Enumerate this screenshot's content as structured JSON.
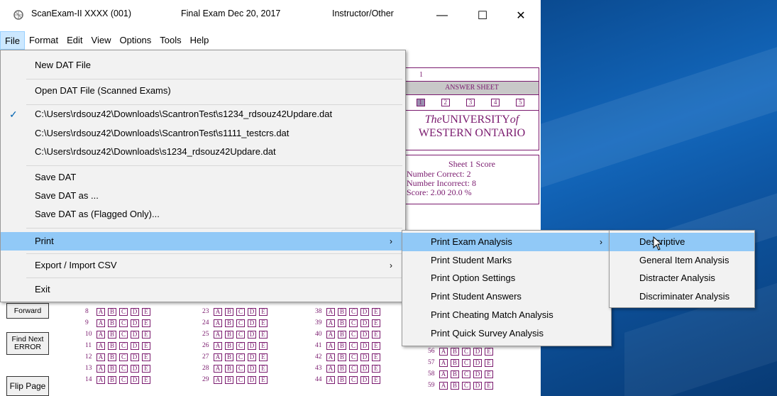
{
  "window": {
    "app_title": "ScanExam-II XXXX (001)",
    "exam_title": "Final Exam Dec 20, 2017",
    "role": "Instructor/Other",
    "controls": {
      "minimize": "—",
      "maximize": "☐",
      "close": "✕"
    }
  },
  "menubar": [
    "File",
    "Format",
    "Edit",
    "View",
    "Options",
    "Tools",
    "Help"
  ],
  "file_menu": {
    "new_dat": "New DAT File",
    "open_dat": "Open DAT File (Scanned Exams)",
    "recent": [
      "C:\\Users\\rdsouz42\\Downloads\\ScantronTest\\s1234_rdsouz42Updare.dat",
      "C:\\Users\\rdsouz42\\Downloads\\ScantronTest\\s1111_testcrs.dat",
      "C:\\Users\\rdsouz42\\Downloads\\s1234_rdsouz42Updare.dat"
    ],
    "checkmark": "✓",
    "save_dat": "Save DAT",
    "save_dat_as": "Save DAT as ...",
    "save_dat_flagged": "Save DAT as (Flagged Only)...",
    "print": "Print",
    "export_import": "Export / Import CSV",
    "exit": "Exit",
    "submenu_arrow": "›"
  },
  "print_menu": [
    "Print Exam Analysis",
    "Print Student Marks",
    "Print Option Settings",
    "Print Student Answers",
    "Print Cheating Match Analysis",
    "Print Quick Survey Analysis"
  ],
  "analysis_menu": [
    "Descriptive",
    "General Item Analysis",
    "Distracter Analysis",
    "Discriminater Analysis"
  ],
  "sheet": {
    "number": "1",
    "answer_sheet": "ANSWER SHEET",
    "tabs": [
      "1",
      "2",
      "3",
      "4",
      "5"
    ],
    "university_line1_italic1": "The",
    "university_line1_caps": "UNIVERSITY",
    "university_line1_italic2": "of",
    "university_line2": "WESTERN ONTARIO",
    "score_title": "Sheet 1 Score",
    "number_correct": "Number Correct:  2",
    "number_incorrect": "Number Incorrect:  8",
    "score": "Score:  2.00   20.0 %"
  },
  "side_buttons": {
    "forward": "Forward",
    "find_next": "Find Next ERROR",
    "flip_page": "Flip Page"
  },
  "bubble_letters": [
    "A",
    "B",
    "C",
    "D",
    "E"
  ],
  "question_columns": [
    [
      "8",
      "9",
      "10",
      "11",
      "12",
      "13",
      "14"
    ],
    [
      "23",
      "24",
      "25",
      "26",
      "27",
      "28",
      "29"
    ],
    [
      "38",
      "39",
      "40",
      "41",
      "42",
      "43",
      "44"
    ],
    [
      "56",
      "57",
      "58",
      "59"
    ]
  ],
  "colors": {
    "menu_highlight": "#91c9f7",
    "accent_purple": "#7a1a6e",
    "desktop_blue": "#0f5aa8"
  }
}
